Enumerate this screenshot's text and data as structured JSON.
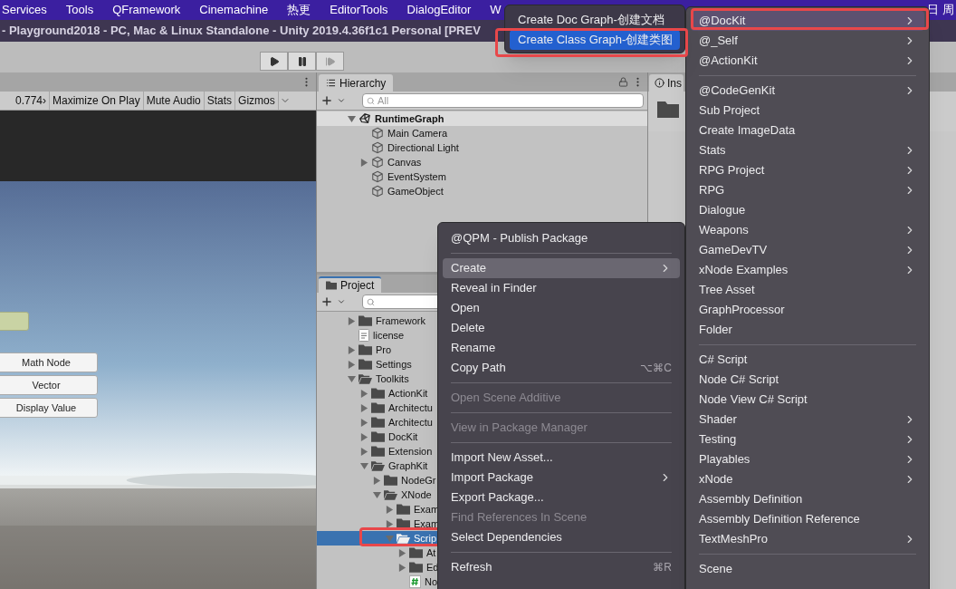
{
  "menu_bar": {
    "items": [
      "Services",
      "Tools",
      "QFramework",
      "Cinemachine",
      "热更",
      "EditorTools",
      "DialogEditor",
      "W"
    ],
    "clock": "日 周"
  },
  "title_bar": {
    "title": "- Playground2018 - PC, Mac & Linux Standalone - Unity 2019.4.36f1c1 Personal [PREV"
  },
  "play_controls": [
    {
      "kind": "play",
      "disabled": false
    },
    {
      "kind": "pause",
      "disabled": false
    },
    {
      "kind": "step",
      "disabled": true
    }
  ],
  "game_view": {
    "toolbar": [
      "0.774›",
      "Maximize On Play",
      "Mute Audio",
      "Stats",
      "Gizmos"
    ],
    "ui_buttons": [
      "Math Node",
      "Vector",
      "Display Value"
    ]
  },
  "hierarchy": {
    "tab": "Hierarchy",
    "search_placeholder": "All",
    "tree": [
      {
        "label": "RuntimeGraph",
        "kind": "scene",
        "expanded": true,
        "children": [
          {
            "label": "Main Camera",
            "kind": "object"
          },
          {
            "label": "Directional Light",
            "kind": "object"
          },
          {
            "label": "Canvas",
            "kind": "object",
            "expanded": false
          },
          {
            "label": "EventSystem",
            "kind": "object"
          },
          {
            "label": "GameObject",
            "kind": "object"
          }
        ]
      }
    ]
  },
  "project": {
    "tab": "Project",
    "tree": [
      {
        "label": "Framework",
        "kind": "folder",
        "expanded": false,
        "selected": false
      },
      {
        "label": "license",
        "kind": "file",
        "selected": false
      },
      {
        "label": "Pro",
        "kind": "folder",
        "expanded": false,
        "selected": false
      },
      {
        "label": "Settings",
        "kind": "folder",
        "expanded": false,
        "selected": false
      },
      {
        "label": "Toolkits",
        "kind": "folder",
        "expanded": true,
        "selected": false,
        "children": [
          {
            "label": "ActionKit",
            "kind": "folder",
            "expanded": false,
            "selected": false
          },
          {
            "label": "Architectu",
            "kind": "folder",
            "expanded": false,
            "selected": false
          },
          {
            "label": "Architectu",
            "kind": "folder",
            "expanded": false,
            "selected": false
          },
          {
            "label": "DocKit",
            "kind": "folder",
            "expanded": false,
            "selected": false
          },
          {
            "label": "Extension",
            "kind": "folder",
            "expanded": false,
            "selected": false
          },
          {
            "label": "GraphKit",
            "kind": "folder",
            "expanded": true,
            "selected": false,
            "children": [
              {
                "label": "NodeGr",
                "kind": "folder",
                "expanded": false,
                "selected": false
              },
              {
                "label": "XNode",
                "kind": "folder",
                "expanded": true,
                "selected": false,
                "children": [
                  {
                    "label": "Exam",
                    "kind": "folder",
                    "expanded": false,
                    "selected": false
                  },
                  {
                    "label": "Exam",
                    "kind": "folder",
                    "expanded": false,
                    "selected": false
                  },
                  {
                    "label": "Scrip",
                    "kind": "folder",
                    "expanded": true,
                    "selected": true,
                    "children": [
                      {
                        "label": "At",
                        "kind": "folder",
                        "expanded": false,
                        "selected": false
                      },
                      {
                        "label": "Ed",
                        "kind": "folder",
                        "expanded": false,
                        "selected": false
                      },
                      {
                        "label": "No",
                        "kind": "script",
                        "selected": false
                      }
                    ]
                  }
                ]
              }
            ]
          }
        ]
      }
    ]
  },
  "inspector": {
    "tab": "Ins"
  },
  "context_menu": {
    "items": [
      {
        "kind": "item",
        "label": "@QPM - Publish Package",
        "has_submenu": false,
        "disabled": false,
        "selected": false
      },
      {
        "kind": "separator"
      },
      {
        "kind": "item",
        "label": "Create",
        "has_submenu": true,
        "disabled": false,
        "selected": true
      },
      {
        "kind": "item",
        "label": "Reveal in Finder",
        "has_submenu": false,
        "disabled": false,
        "selected": false
      },
      {
        "kind": "item",
        "label": "Open",
        "has_submenu": false,
        "disabled": false,
        "selected": false
      },
      {
        "kind": "item",
        "label": "Delete",
        "has_submenu": false,
        "disabled": false,
        "selected": false
      },
      {
        "kind": "item",
        "label": "Rename",
        "has_submenu": false,
        "disabled": false,
        "selected": false
      },
      {
        "kind": "item",
        "label": "Copy Path",
        "shortcut": "⌥⌘C",
        "has_submenu": false,
        "disabled": false,
        "selected": false
      },
      {
        "kind": "separator"
      },
      {
        "kind": "item",
        "label": "Open Scene Additive",
        "has_submenu": false,
        "disabled": true,
        "selected": false
      },
      {
        "kind": "separator"
      },
      {
        "kind": "item",
        "label": "View in Package Manager",
        "has_submenu": false,
        "disabled": true,
        "selected": false
      },
      {
        "kind": "separator"
      },
      {
        "kind": "item",
        "label": "Import New Asset...",
        "has_submenu": false,
        "disabled": false,
        "selected": false
      },
      {
        "kind": "item",
        "label": "Import Package",
        "has_submenu": true,
        "disabled": false,
        "selected": false
      },
      {
        "kind": "item",
        "label": "Export Package...",
        "has_submenu": false,
        "disabled": false,
        "selected": false
      },
      {
        "kind": "item",
        "label": "Find References In Scene",
        "has_submenu": false,
        "disabled": true,
        "selected": false
      },
      {
        "kind": "item",
        "label": "Select Dependencies",
        "has_submenu": false,
        "disabled": false,
        "selected": false
      },
      {
        "kind": "separator"
      },
      {
        "kind": "item",
        "label": "Refresh",
        "shortcut": "⌘R",
        "has_submenu": false,
        "disabled": false,
        "selected": false
      }
    ]
  },
  "create_submenu": {
    "items": [
      {
        "kind": "item",
        "label": "@DocKit",
        "has_submenu": true,
        "selected": true
      },
      {
        "kind": "item",
        "label": "@_Self",
        "has_submenu": true,
        "selected": false
      },
      {
        "kind": "item",
        "label": "@ActionKit",
        "has_submenu": true,
        "selected": false
      },
      {
        "kind": "separator"
      },
      {
        "kind": "item",
        "label": "@CodeGenKit",
        "has_submenu": true,
        "selected": false
      },
      {
        "kind": "item",
        "label": "Sub Project",
        "has_submenu": false,
        "selected": false
      },
      {
        "kind": "item",
        "label": "Create ImageData",
        "has_submenu": false,
        "selected": false
      },
      {
        "kind": "item",
        "label": "Stats",
        "has_submenu": true,
        "selected": false
      },
      {
        "kind": "item",
        "label": "RPG Project",
        "has_submenu": true,
        "selected": false
      },
      {
        "kind": "item",
        "label": "RPG",
        "has_submenu": true,
        "selected": false
      },
      {
        "kind": "item",
        "label": "Dialogue",
        "has_submenu": false,
        "selected": false
      },
      {
        "kind": "item",
        "label": "Weapons",
        "has_submenu": true,
        "selected": false
      },
      {
        "kind": "item",
        "label": "GameDevTV",
        "has_submenu": true,
        "selected": false
      },
      {
        "kind": "item",
        "label": "xNode Examples",
        "has_submenu": true,
        "selected": false
      },
      {
        "kind": "item",
        "label": "Tree Asset",
        "has_submenu": false,
        "selected": false
      },
      {
        "kind": "item",
        "label": "GraphProcessor",
        "has_submenu": false,
        "selected": false
      },
      {
        "kind": "item",
        "label": "Folder",
        "has_submenu": false,
        "selected": false
      },
      {
        "kind": "separator"
      },
      {
        "kind": "item",
        "label": "C# Script",
        "has_submenu": false,
        "selected": false
      },
      {
        "kind": "item",
        "label": "Node C# Script",
        "has_submenu": false,
        "selected": false
      },
      {
        "kind": "item",
        "label": "Node View C# Script",
        "has_submenu": false,
        "selected": false
      },
      {
        "kind": "item",
        "label": "Shader",
        "has_submenu": true,
        "selected": false
      },
      {
        "kind": "item",
        "label": "Testing",
        "has_submenu": true,
        "selected": false
      },
      {
        "kind": "item",
        "label": "Playables",
        "has_submenu": true,
        "selected": false
      },
      {
        "kind": "item",
        "label": "xNode",
        "has_submenu": true,
        "selected": false
      },
      {
        "kind": "item",
        "label": "Assembly Definition",
        "has_submenu": false,
        "selected": false
      },
      {
        "kind": "item",
        "label": "Assembly Definition Reference",
        "has_submenu": false,
        "selected": false
      },
      {
        "kind": "item",
        "label": "TextMeshPro",
        "has_submenu": true,
        "selected": false
      },
      {
        "kind": "separator"
      },
      {
        "kind": "item",
        "label": "Scene",
        "has_submenu": false,
        "selected": false
      }
    ]
  },
  "dockit_submenu": {
    "items": [
      {
        "kind": "item",
        "label": "Create Doc Graph-创建文档",
        "selected": false
      },
      {
        "kind": "item",
        "label": "Create Class Graph-创建类图",
        "selected": true
      }
    ]
  }
}
